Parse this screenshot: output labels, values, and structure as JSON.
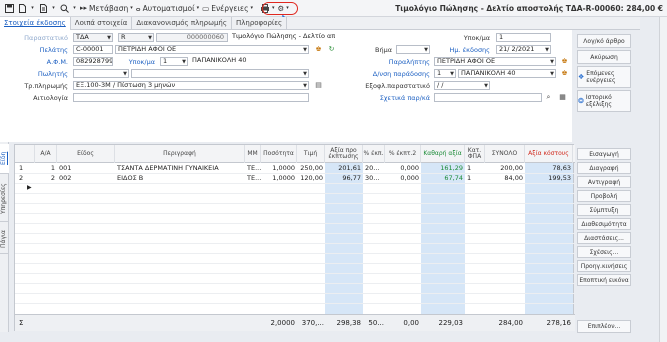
{
  "toolbar": {
    "metavasi": "Μετάβαση",
    "automatismoi": "Αυτοματισμοί",
    "energeies": "Ενέργειες",
    "window_title": "Τιμολόγιο Πώλησης - Δελτίο αποστολής ΤΔΑ-R-00060: 284,00 €"
  },
  "tabs": [
    {
      "label": "Στοιχεία έκδοσης"
    },
    {
      "label": "Λοιπά στοιχεία"
    },
    {
      "label": "Διακανονισμός πληρωμής"
    },
    {
      "label": "Πληροφορίες"
    }
  ],
  "form": {
    "labels": {
      "parastatiko": "Παραστατικό",
      "pelatis": "Πελάτης",
      "afm": "Α.Φ.Μ.",
      "ypok1": "Υποκ/μα",
      "pwlitis": "Πωλητής",
      "tropos": "Τρ.πληρωμής",
      "aitiologia": "Αιτιολογία",
      "ypok_r": "Υποκ/μα",
      "vima": "Βήμα",
      "hm_ekdosis": "Ημ. έκδοσης",
      "paralipths": "Παραλήπτης",
      "dnsi": "Δ/νση παράδοσης",
      "eksol": "Εξοφλ.παραστατικό",
      "sxetika": "Σχετικά παρ/κά"
    },
    "values": {
      "series": "ΤΔΑ",
      "r": "R",
      "number": "000000060",
      "doc_type": "Τιμολόγιο Πώλησης - Δελτίο αποστολής",
      "ypok_val": "1",
      "customer_code": "C-00001",
      "customer_name": "ΠΕΤΡΙΔΗ ΑΦΟΙ ΟΕ",
      "date": "21/ 2/2021",
      "afm": "082928799",
      "ypok1_val": "1",
      "address": "ΠΑΠΑΝΙΚΟΛΗ 40",
      "receiver": "ΠΕΤΡΙΔΗ ΑΦΟΙ ΟΕ",
      "delivery_no": "1",
      "delivery_addr": "ΠΑΠΑΝΙΚΟΛΗ 40",
      "payment": "ΕΞ.100-3Μ / Πίστωση 3 μηνών",
      "eksol_date": "/ /"
    }
  },
  "right_buttons": [
    "Λογ/κό άρθρο",
    "Ακύρωση",
    "Επόμενες ενέργειες",
    "Ιστορικό εξέλιξης",
    "Εισαγωγή",
    "Διαγραφή",
    "Αντιγραφή",
    "Προβολή",
    "Σύμπτυξη",
    "Διαθεσιμότητα",
    "Διαστάσεις...",
    "Σχέσεις...",
    "Προηγ.κινήσεις",
    "Εποπτική εικόνα",
    "Επιπλέον..."
  ],
  "vtabs": [
    "Είδη",
    "Υπηρεσίες",
    "Πάγια"
  ],
  "grid": {
    "headers": [
      "Α/Α",
      "Είδος",
      "Περιγραφή",
      "ΜΜ",
      "Ποσότητα",
      "Τιμή",
      "Αξία προ έκπτωσης",
      "% έκπ.",
      "% έκπτ.2",
      "Καθαρή αξία",
      "Κατ. ΦΠΑ",
      "ΣΥΝΟΛΟ",
      "Αξία κόστους"
    ],
    "rows": [
      {
        "n": "1",
        "aa": "1",
        "code": "001",
        "desc": "ΤΣΑΝΤΑ ΔΕΡΜΑΤΙΝΗ ΓΥΝΑΙΚΕΙΑ",
        "mm": "ΤΕ...",
        "qty": "1,0000",
        "price": "250,00",
        "gross": "201,61",
        "d1": "20...",
        "d2": "0,000",
        "net": "161,29",
        "vat": "1",
        "total": "200,00",
        "cost": "78,63"
      },
      {
        "n": "2",
        "aa": "2",
        "code": "002",
        "desc": "ΕΙΔΟΣ Β",
        "mm": "ΤΕ...",
        "qty": "1,0000",
        "price": "120,00",
        "gross": "96,77",
        "d1": "30...",
        "d2": "0,000",
        "net": "67,74",
        "vat": "1",
        "total": "84,00",
        "cost": "199,53"
      }
    ],
    "footer": {
      "sigma": "Σ",
      "qty": "2,0000",
      "price": "370,...",
      "gross": "298,38",
      "d1": "50...",
      "d2": "0,00",
      "net": "229,03",
      "total": "284,00",
      "cost": "278,16"
    }
  },
  "colors": {
    "accent": "#1b5fc2",
    "highlight": "#e0281f",
    "net_green": "#1a8a36",
    "column_blue": "#d6e6f7"
  }
}
